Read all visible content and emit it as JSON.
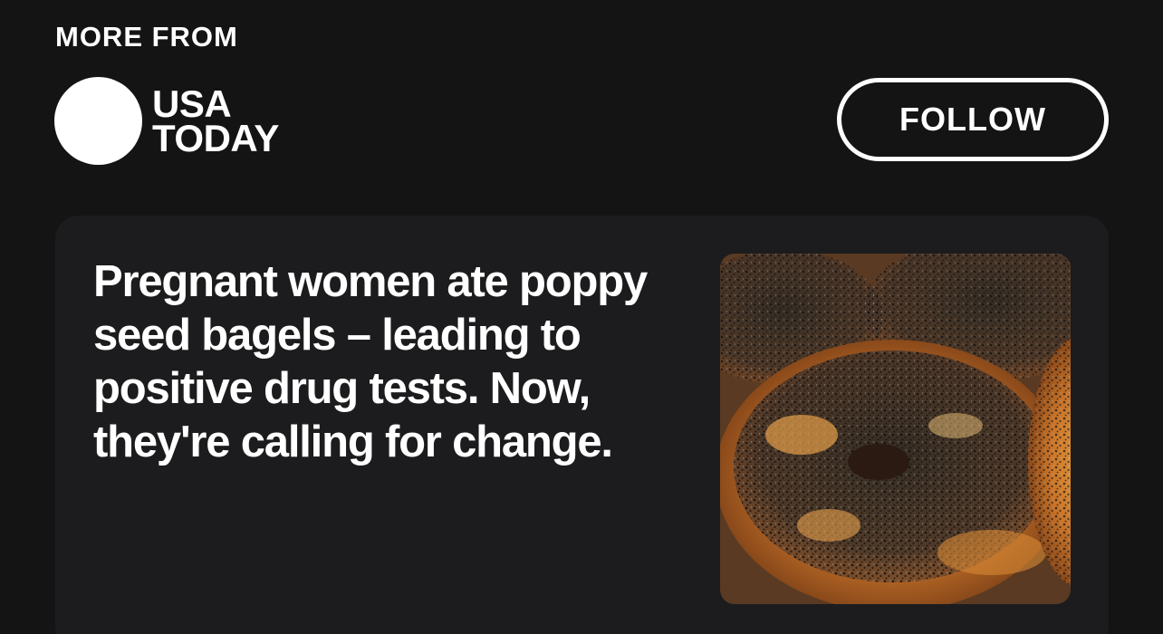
{
  "section": {
    "label": "MORE FROM"
  },
  "publisher": {
    "name_line1": "USA",
    "name_line2": "TODAY",
    "logo_color": "#ffffff"
  },
  "follow_button": {
    "label": "FOLLOW"
  },
  "article": {
    "headline": "Pregnant women ate poppy seed bagels – leading to positive drug tests. Now, they're calling for change.",
    "thumbnail": "poppy-seed-bagels-photo"
  },
  "colors": {
    "background": "#141415",
    "card": "#1c1c1e",
    "text": "#ffffff"
  }
}
